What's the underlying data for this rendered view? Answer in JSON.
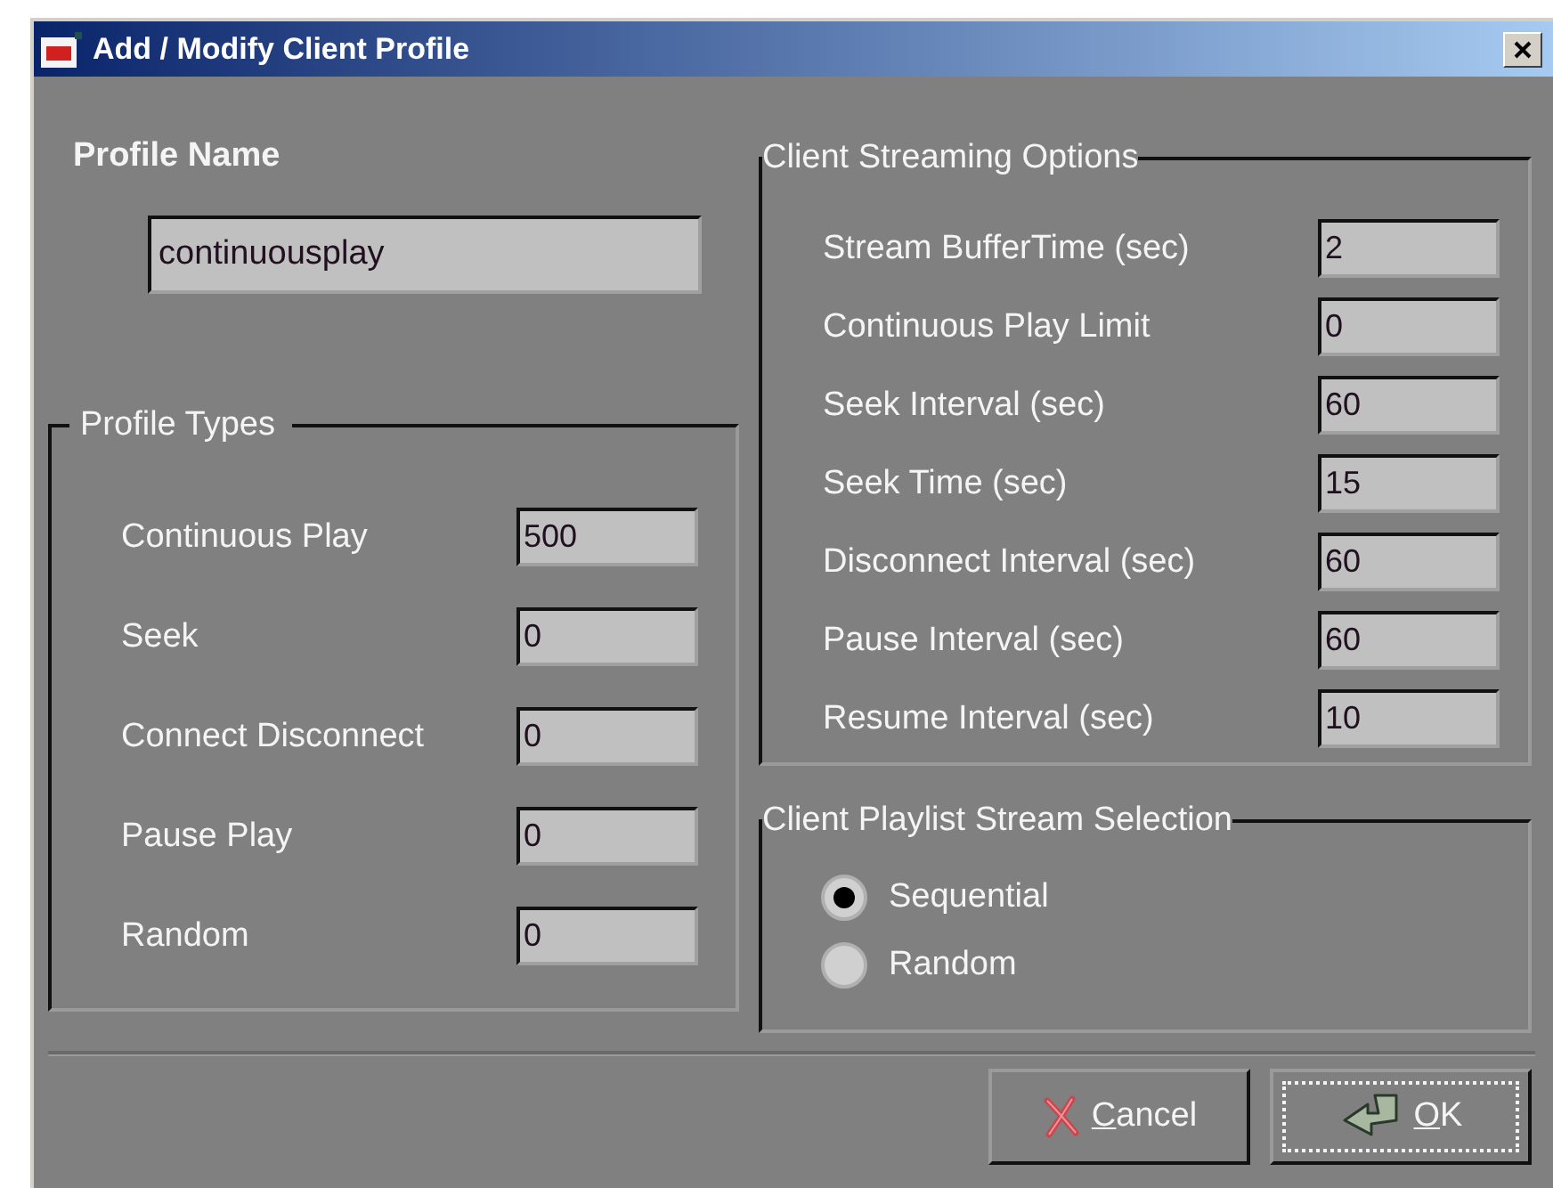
{
  "window": {
    "title": "Add / Modify Client Profile"
  },
  "profile_name": {
    "label": "Profile Name",
    "value": "continuousplay"
  },
  "profile_types": {
    "title": "Profile Types",
    "rows": [
      {
        "label": "Continuous Play",
        "value": "500"
      },
      {
        "label": "Seek",
        "value": "0"
      },
      {
        "label": "Connect Disconnect",
        "value": "0"
      },
      {
        "label": "Pause Play",
        "value": "0"
      },
      {
        "label": "Random",
        "value": "0"
      }
    ]
  },
  "streaming_options": {
    "title": "Client Streaming Options",
    "rows": [
      {
        "label": "Stream BufferTime (sec)",
        "value": "2"
      },
      {
        "label": "Continuous Play Limit",
        "value": "0"
      },
      {
        "label": "Seek Interval (sec)",
        "value": "60"
      },
      {
        "label": "Seek Time (sec)",
        "value": "15"
      },
      {
        "label": "Disconnect Interval (sec)",
        "value": "60"
      },
      {
        "label": "Pause Interval (sec)",
        "value": "60"
      },
      {
        "label": "Resume Interval (sec)",
        "value": "10"
      }
    ]
  },
  "playlist_selection": {
    "title": "Client Playlist Stream Selection",
    "options": [
      {
        "label": "Sequential",
        "selected": true
      },
      {
        "label": "Random",
        "selected": false
      }
    ]
  },
  "buttons": [
    {
      "kind": "cancel",
      "label": "Cancel",
      "focused": false
    },
    {
      "kind": "ok",
      "label": "OK",
      "focused": true
    }
  ]
}
